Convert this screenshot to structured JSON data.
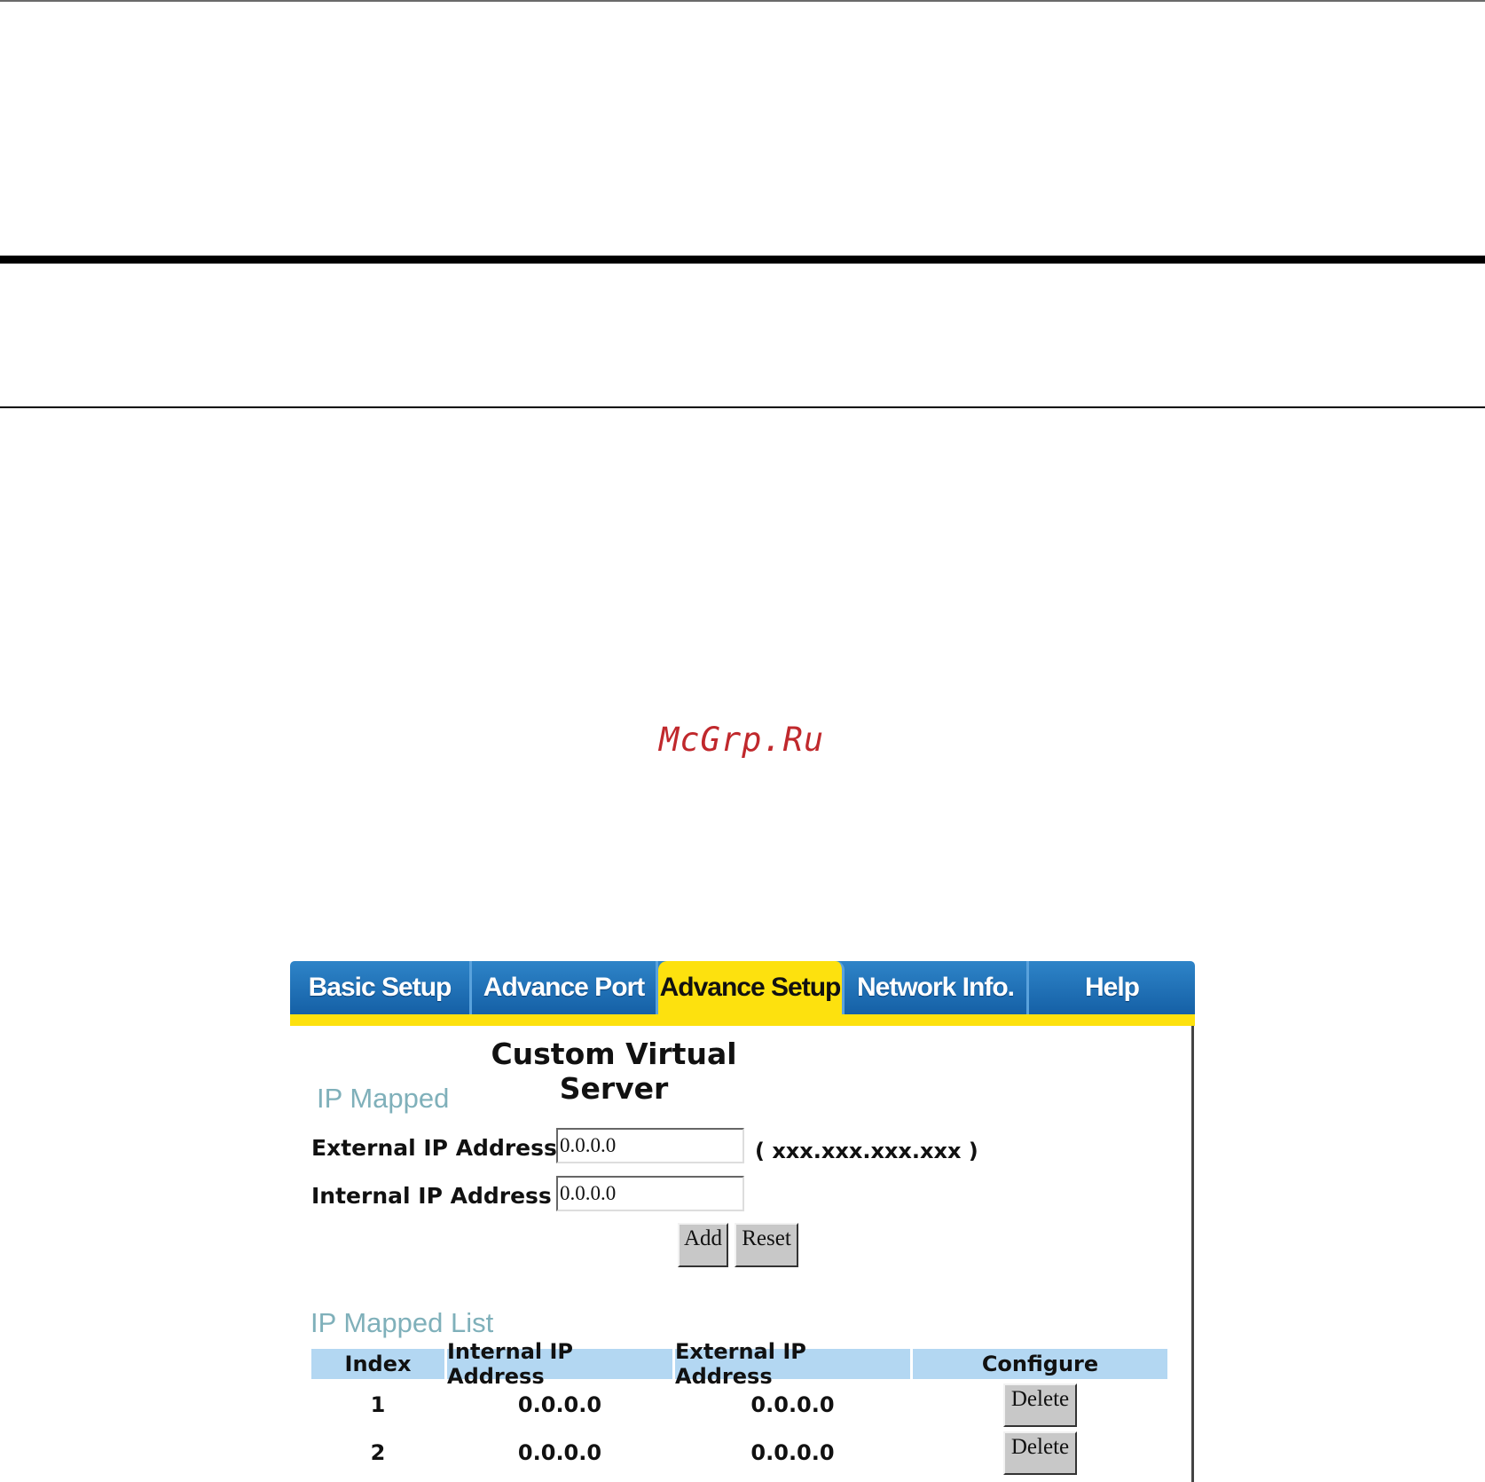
{
  "watermark": "McGrp.Ru",
  "tabs": [
    {
      "label": "Basic Setup",
      "active": false
    },
    {
      "label": "Advance Port",
      "active": false
    },
    {
      "label": "Advance Setup",
      "active": true
    },
    {
      "label": "Network Info.",
      "active": false
    },
    {
      "label": "Help",
      "active": false
    }
  ],
  "page_title": "Custom Virtual Server",
  "ip_mapped": {
    "section_title": "IP Mapped",
    "external_label": "External IP Address",
    "external_value": "0.0.0.0",
    "format_hint": "( xxx.xxx.xxx.xxx )",
    "internal_label": "Internal IP Address",
    "internal_value": "0.0.0.0",
    "add_label": "Add",
    "reset_label": "Reset"
  },
  "ip_mapped_list": {
    "section_title": "IP Mapped List",
    "columns": [
      "Index",
      "Internal IP Address",
      "External IP Address",
      "Configure"
    ],
    "rows": [
      {
        "index": "1",
        "internal": "0.0.0.0",
        "external": "0.0.0.0",
        "action": "Delete"
      },
      {
        "index": "2",
        "internal": "0.0.0.0",
        "external": "0.0.0.0",
        "action": "Delete"
      }
    ]
  },
  "colors": {
    "tab_blue": "#1f72b8",
    "tab_active_yellow": "#fde10e",
    "section_title": "#7fb0ba",
    "table_header": "#b3d7f2",
    "watermark": "#c0282c"
  }
}
